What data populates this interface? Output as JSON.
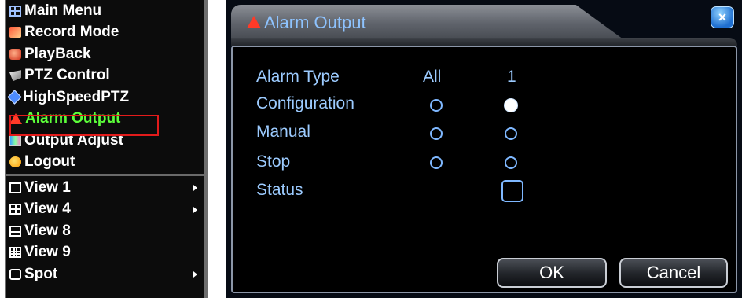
{
  "menu": {
    "items": [
      {
        "label": "Main Menu",
        "icon": "main-menu-icon"
      },
      {
        "label": "Record Mode",
        "icon": "record-mode-icon"
      },
      {
        "label": "PlayBack",
        "icon": "playback-icon"
      },
      {
        "label": "PTZ Control",
        "icon": "ptz-control-icon"
      },
      {
        "label": "HighSpeedPTZ",
        "icon": "highspeed-ptz-icon"
      },
      {
        "label": "Alarm Output",
        "icon": "alarm-output-icon",
        "selected": true
      },
      {
        "label": "Output Adjust",
        "icon": "output-adjust-icon"
      },
      {
        "label": "Logout",
        "icon": "logout-icon"
      },
      {
        "label": "View 1",
        "icon": "view-1-icon",
        "submenu": true
      },
      {
        "label": "View 4",
        "icon": "view-4-icon",
        "submenu": true
      },
      {
        "label": "View 8",
        "icon": "view-8-icon"
      },
      {
        "label": "View 9",
        "icon": "view-9-icon"
      },
      {
        "label": "Spot",
        "icon": "spot-icon",
        "submenu": true
      }
    ]
  },
  "dialog": {
    "title": "Alarm Output",
    "close_label": "×",
    "columns": [
      "All",
      "1"
    ],
    "rows": {
      "alarm_type": "Alarm Type",
      "configuration": "Configuration",
      "manual": "Manual",
      "stop": "Stop",
      "status": "Status"
    },
    "selection": {
      "configuration": "1",
      "manual": null,
      "stop": null
    },
    "status_checked": false,
    "ok_label": "OK",
    "cancel_label": "Cancel"
  },
  "colors": {
    "accent_text": "#9ccbff",
    "selected_menu_text": "#5cff3a",
    "selection_box": "#e31b1b",
    "title_text": "#8ec3ff"
  }
}
